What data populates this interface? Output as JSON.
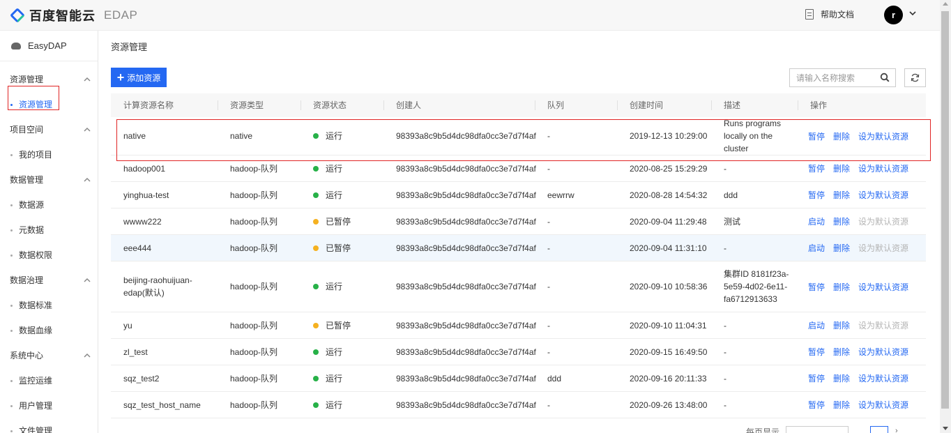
{
  "header": {
    "logo_text": "百度智能云",
    "product_name": "EDAP",
    "help_label": "帮助文档",
    "avatar_letter": "r"
  },
  "sidebar": {
    "brand": "EasyDAP",
    "groups": [
      {
        "label": "资源管理",
        "items": [
          {
            "label": "资源管理",
            "active": true
          }
        ]
      },
      {
        "label": "项目空间",
        "items": [
          {
            "label": "我的项目"
          }
        ]
      },
      {
        "label": "数据管理",
        "items": [
          {
            "label": "数据源"
          },
          {
            "label": "元数据"
          },
          {
            "label": "数据权限"
          }
        ]
      },
      {
        "label": "数据治理",
        "items": [
          {
            "label": "数据标准"
          },
          {
            "label": "数据血缘"
          }
        ]
      },
      {
        "label": "系统中心",
        "items": [
          {
            "label": "监控运维"
          },
          {
            "label": "用户管理"
          },
          {
            "label": "文件管理"
          }
        ]
      }
    ]
  },
  "main": {
    "title": "资源管理",
    "add_button": "添加资源",
    "search_placeholder": "请输入名称搜索",
    "columns": [
      "计算资源名称",
      "资源类型",
      "资源状态",
      "创建人",
      "队列",
      "创建时间",
      "描述",
      "操作"
    ],
    "rows": [
      {
        "name": "native",
        "type": "native",
        "status": "运行",
        "status_color": "#27b148",
        "creator": "98393a8c9b5d4dc98dfa0cc3e7d7f4af",
        "queue": "-",
        "created": "2019-12-13 10:29:00",
        "desc": "Runs programs locally on the cluster",
        "ops": [
          "暂停",
          "删除",
          "设为默认资源"
        ],
        "set_default_enabled": true,
        "height": 55
      },
      {
        "name": "hadoop001",
        "type": "hadoop-队列",
        "status": "运行",
        "status_color": "#27b148",
        "creator": "98393a8c9b5d4dc98dfa0cc3e7d7f4af",
        "queue": "-",
        "created": "2020-08-25 15:29:29",
        "desc": "-",
        "ops": [
          "暂停",
          "删除",
          "设为默认资源"
        ],
        "set_default_enabled": true,
        "height": 38
      },
      {
        "name": "yinghua-test",
        "type": "hadoop-队列",
        "status": "运行",
        "status_color": "#27b148",
        "creator": "98393a8c9b5d4dc98dfa0cc3e7d7f4af",
        "queue": "eewrrw",
        "created": "2020-08-28 14:54:32",
        "desc": "ddd",
        "ops": [
          "暂停",
          "删除",
          "设为默认资源"
        ],
        "set_default_enabled": true,
        "height": 38
      },
      {
        "name": "wwww222",
        "type": "hadoop-队列",
        "status": "已暂停",
        "status_color": "#f5b120",
        "creator": "98393a8c9b5d4dc98dfa0cc3e7d7f4af",
        "queue": "-",
        "created": "2020-09-04 11:29:48",
        "desc": "测试",
        "ops": [
          "启动",
          "删除",
          "设为默认资源"
        ],
        "set_default_enabled": false,
        "height": 38
      },
      {
        "name": "eee444",
        "type": "hadoop-队列",
        "status": "已暂停",
        "status_color": "#f5b120",
        "creator": "98393a8c9b5d4dc98dfa0cc3e7d7f4af",
        "queue": "-",
        "created": "2020-09-04 11:31:10",
        "desc": "-",
        "ops": [
          "启动",
          "删除",
          "设为默认资源"
        ],
        "set_default_enabled": false,
        "height": 38,
        "highlight": true
      },
      {
        "name": "beijing-raohuijuan-edap(默认)",
        "type": "hadoop-队列",
        "status": "运行",
        "status_color": "#27b148",
        "creator": "98393a8c9b5d4dc98dfa0cc3e7d7f4af",
        "queue": "-",
        "created": "2020-09-10 10:58:36",
        "desc": "集群ID 8181f23a-5e59-4d02-6e11-fa6712913633",
        "ops": [
          "暂停",
          "删除",
          "设为默认资源"
        ],
        "set_default_enabled": true,
        "height": 73
      },
      {
        "name": "yu",
        "type": "hadoop-队列",
        "status": "已暂停",
        "status_color": "#f5b120",
        "creator": "98393a8c9b5d4dc98dfa0cc3e7d7f4af",
        "queue": "-",
        "created": "2020-09-10 11:04:31",
        "desc": "-",
        "ops": [
          "启动",
          "删除",
          "设为默认资源"
        ],
        "set_default_enabled": false,
        "height": 38
      },
      {
        "name": "zl_test",
        "type": "hadoop-队列",
        "status": "运行",
        "status_color": "#27b148",
        "creator": "98393a8c9b5d4dc98dfa0cc3e7d7f4af",
        "queue": "-",
        "created": "2020-09-15 16:49:50",
        "desc": "-",
        "ops": [
          "暂停",
          "删除",
          "设为默认资源"
        ],
        "set_default_enabled": true,
        "height": 38
      },
      {
        "name": "sqz_test2",
        "type": "hadoop-队列",
        "status": "运行",
        "status_color": "#27b148",
        "creator": "98393a8c9b5d4dc98dfa0cc3e7d7f4af",
        "queue": "ddd",
        "created": "2020-09-16 20:11:33",
        "desc": "-",
        "ops": [
          "暂停",
          "删除",
          "设为默认资源"
        ],
        "set_default_enabled": true,
        "height": 38
      },
      {
        "name": "sqz_test_host_name",
        "type": "hadoop-队列",
        "status": "运行",
        "status_color": "#27b148",
        "creator": "98393a8c9b5d4dc98dfa0cc3e7d7f4af",
        "queue": "-",
        "created": "2020-09-26 13:48:00",
        "desc": "-",
        "ops": [
          "暂停",
          "删除",
          "设为默认资源"
        ],
        "set_default_enabled": true,
        "height": 38
      }
    ],
    "pagination": {
      "page_size_label": "每页显示"
    }
  },
  "colors": {
    "accent": "#2468f2",
    "running": "#27b148",
    "paused": "#f5b120",
    "highlight_border": "#e02424"
  }
}
